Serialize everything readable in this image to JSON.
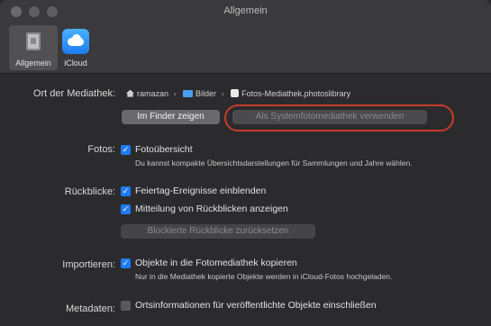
{
  "window": {
    "title": "Allgemein"
  },
  "toolbar": {
    "tabs": [
      {
        "label": "Allgemein",
        "icon": "general-prefs-icon"
      },
      {
        "label": "iCloud",
        "icon": "icloud-icon"
      }
    ]
  },
  "library": {
    "label": "Ort der Mediathek:",
    "path": [
      "ramazan",
      "Bilder",
      "Fotos-Mediathek.photoslibrary"
    ],
    "separator": "›",
    "finder_button": "Im Finder zeigen",
    "system_button": "Als Systemfotomediathek verwenden"
  },
  "photos": {
    "label": "Fotos:",
    "option": "Fotoübersicht",
    "description": "Du kannst kompakte Übersichtsdarstellungen für Sammlungen und Jahre wählen.",
    "checked": true
  },
  "memories": {
    "label": "Rückblicke:",
    "option1": "Feiertag-Ereignisse einblenden",
    "option2": "Mitteilung von Rückblicken anzeigen",
    "reset_button": "Blockierte Rückblicke zurücksetzen"
  },
  "import": {
    "label": "Importieren:",
    "option": "Objekte in die Fotomediathek kopieren",
    "description": "Nur in die Mediathek kopierte Objekte werden in iCloud-Fotos hochgeladen."
  },
  "metadata": {
    "label": "Metadaten:",
    "option": "Ortsinformationen für veröffentlichte Objekte einschließen",
    "checked": false
  },
  "colors": {
    "accent": "#1f7bf2",
    "highlight": "#c93a2a"
  }
}
